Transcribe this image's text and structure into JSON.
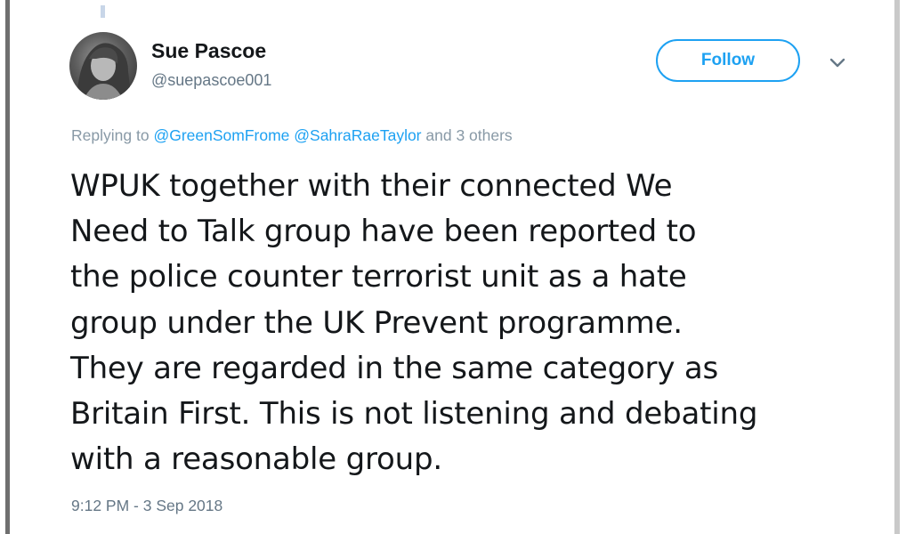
{
  "author": {
    "name": "Sue Pascoe",
    "handle": "@suepascoe001"
  },
  "follow_button": {
    "label": "Follow"
  },
  "reply": {
    "prefix": "Replying to",
    "mentions": [
      "@GreenSomFrome",
      "@SahraRaeTaylor"
    ],
    "suffix": "and 3 others"
  },
  "tweet": {
    "lines": [
      "WPUK together with their connected We",
      "Need to Talk group have been reported to",
      "the police counter terrorist unit as a hate",
      "group under the UK Prevent programme.",
      "They are regarded in the same category as",
      "Britain First. This is not listening and debating",
      "with a reasonable group."
    ]
  },
  "timestamp": "9:12 PM - 3 Sep 2018",
  "icons": {
    "menu": "chevron-down-icon"
  },
  "colors": {
    "accent": "#1da1f2",
    "text": "#14171a",
    "muted": "#657786"
  }
}
